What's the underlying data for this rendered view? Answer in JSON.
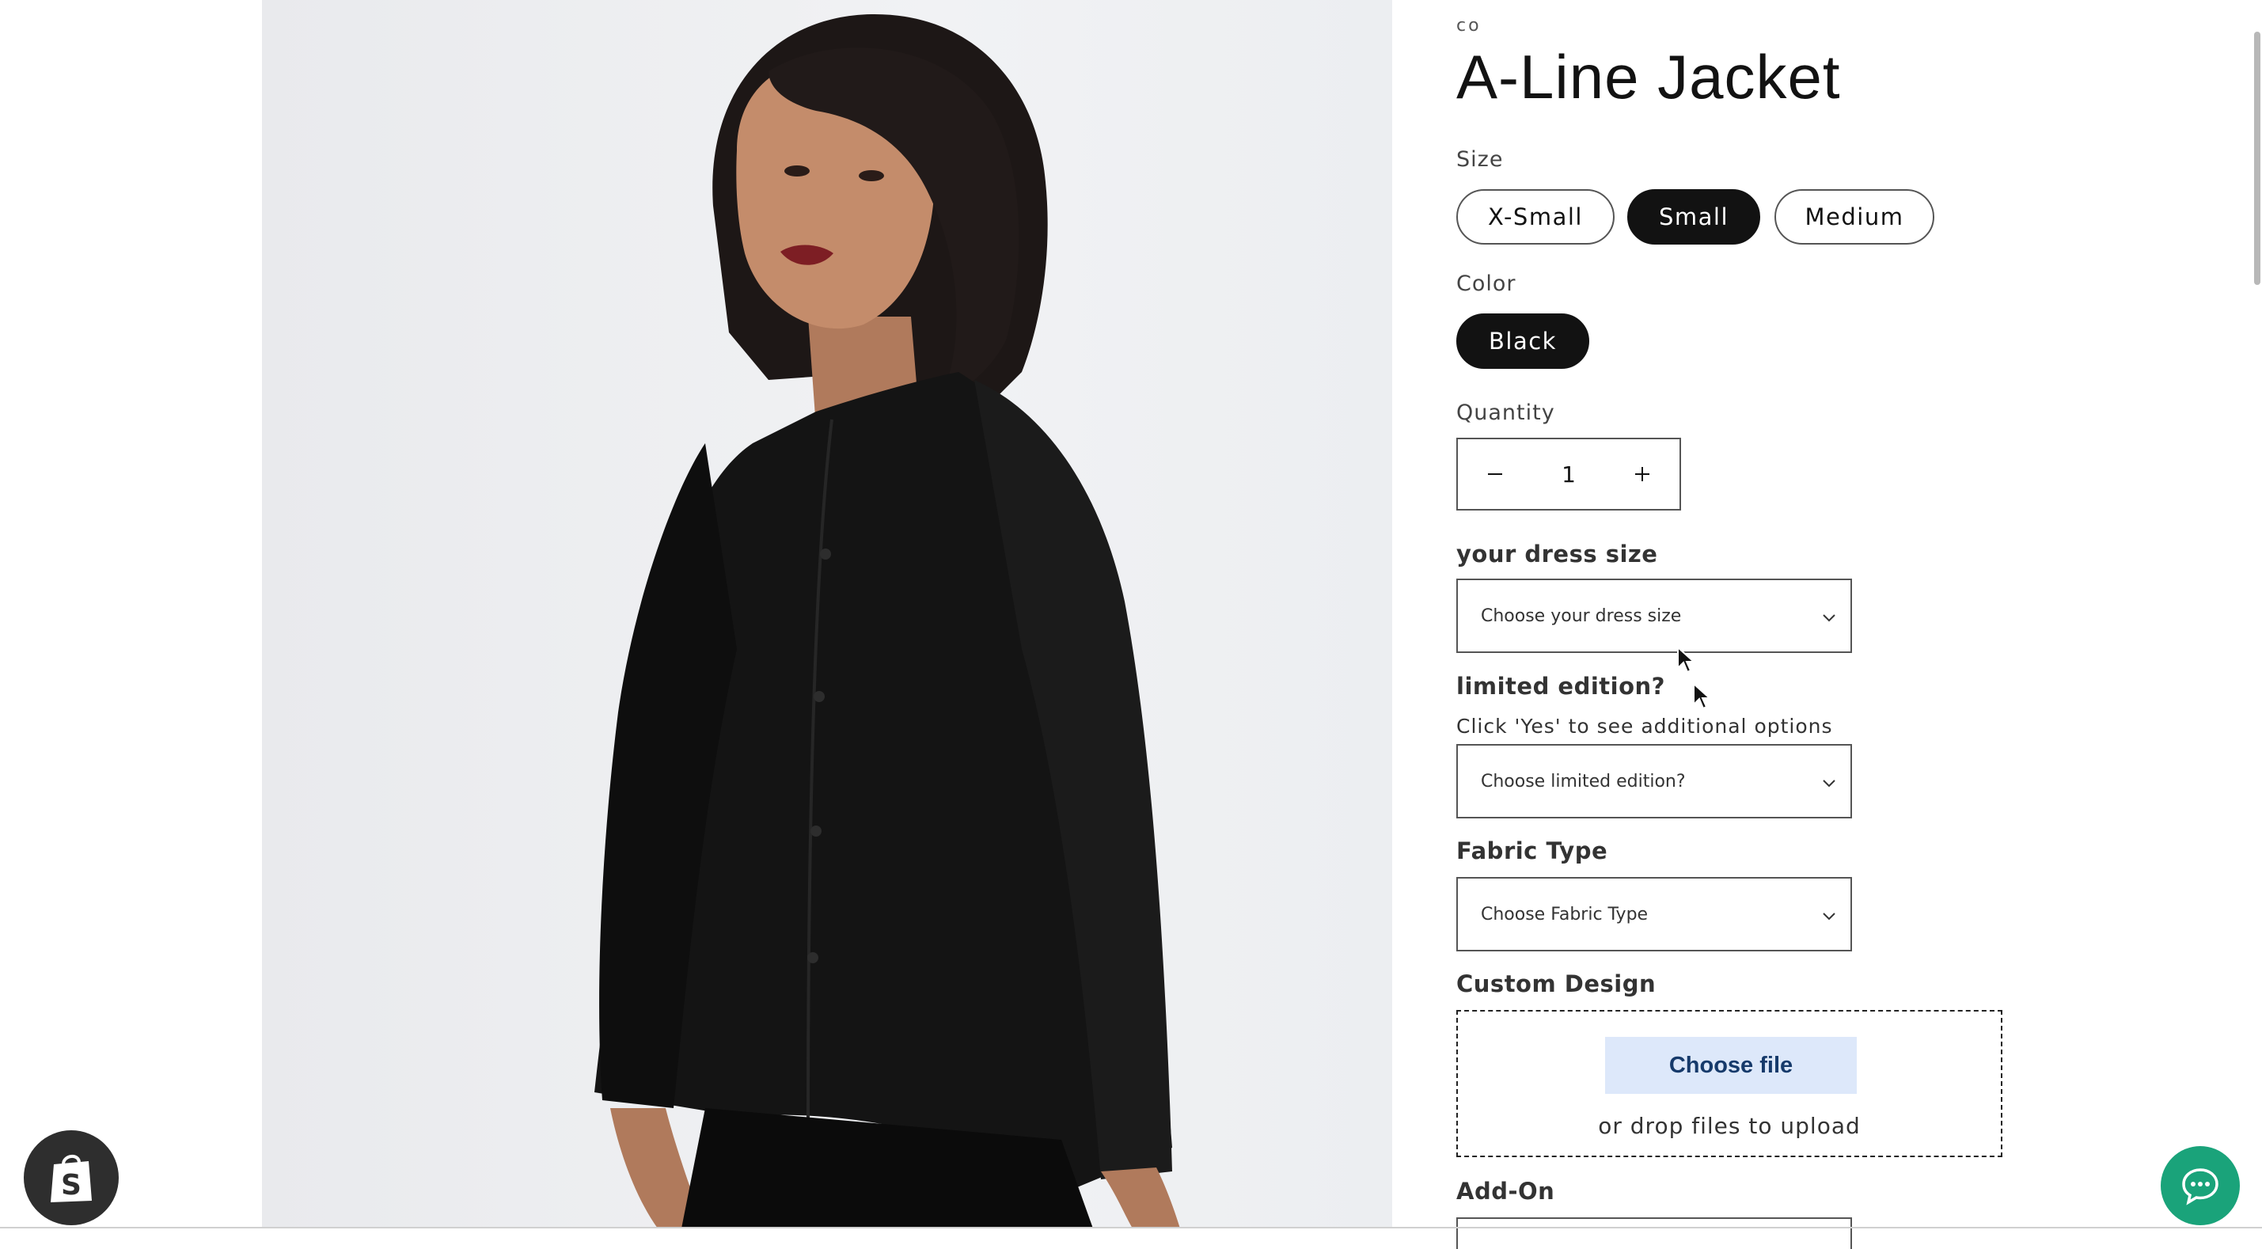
{
  "product": {
    "vendor": "co",
    "title": "A-Line Jacket"
  },
  "size": {
    "label": "Size",
    "options": [
      "X-Small",
      "Small",
      "Medium"
    ],
    "selected": "Small"
  },
  "color": {
    "label": "Color",
    "options": [
      "Black"
    ],
    "selected": "Black"
  },
  "quantity": {
    "label": "Quantity",
    "value": "1",
    "decrease_icon": "minus-icon",
    "increase_icon": "plus-icon"
  },
  "dress_size": {
    "label": "your dress size",
    "placeholder": "Choose your dress size"
  },
  "limited_edition": {
    "label": "limited edition?",
    "hint": "Click 'Yes' to see additional options",
    "placeholder": "Choose limited edition?"
  },
  "fabric_type": {
    "label": "Fabric Type",
    "placeholder": "Choose Fabric Type"
  },
  "custom_design": {
    "label": "Custom Design",
    "button_label": "Choose file",
    "drop_text": "or drop files to upload"
  },
  "add_on": {
    "label": "Add-On"
  },
  "widgets": {
    "shop_badge_icon": "shopify-bag-icon",
    "chat_icon": "chat-bubble-icon"
  },
  "colors": {
    "accent_dark": "#121212",
    "chat_green": "#1aa37a",
    "upload_button_bg": "#dde8fa",
    "upload_button_text": "#163a6b"
  }
}
